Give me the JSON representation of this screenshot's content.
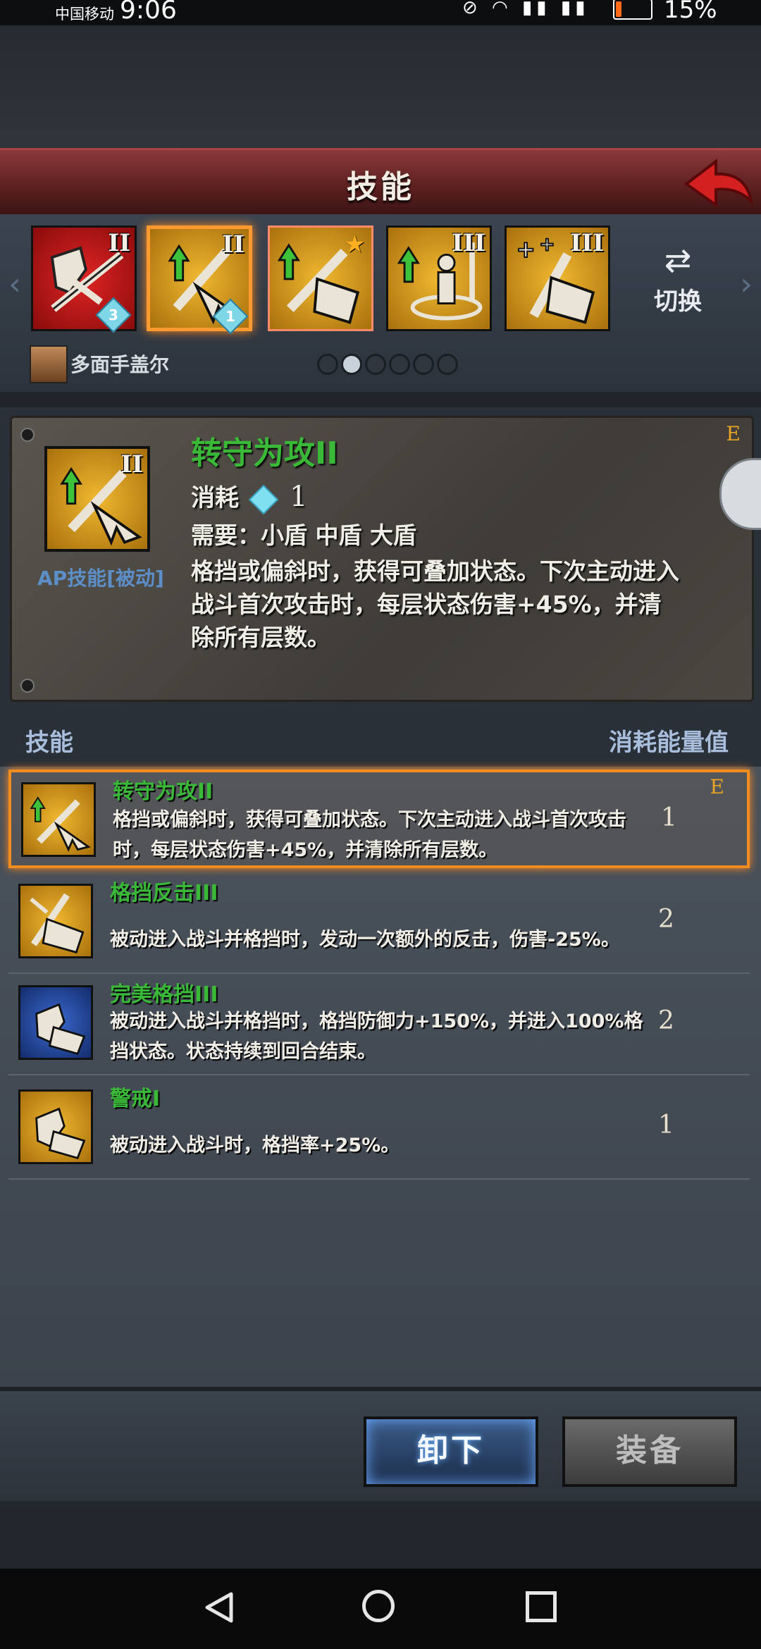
{
  "status_bar": {
    "carrier": "中国移动",
    "time": "9:06",
    "battery": "15%"
  },
  "header": {
    "title": "技能"
  },
  "skill_strip": {
    "slots": [
      {
        "rank": "II",
        "badge": "3",
        "icon": "shield-break-sword-icon"
      },
      {
        "rank": "II",
        "badge": "1",
        "icon": "sword-up-arrow-icon"
      },
      {
        "rank": "",
        "badge": "",
        "icon": "shield-parry-star-icon"
      },
      {
        "rank": "III",
        "badge": "",
        "icon": "guard-stance-icon"
      },
      {
        "rank": "III",
        "badge": "",
        "icon": "shield-plus-icon"
      }
    ],
    "switch_label": "切换",
    "character_name": "多面手盖尔",
    "page_count": 6,
    "active_page": 2
  },
  "detail": {
    "rank": "II",
    "ap_label": "AP技能[被动]",
    "title": "转守为攻II",
    "e_mark": "E",
    "cost_label": "消耗",
    "cost_value": "1",
    "requirement": "需要：小盾 中盾 大盾",
    "description": "格挡或偏斜时，获得可叠加状态。下次主动进入战斗首次攻击时，每层状态伤害+45%，并清除所有层数。"
  },
  "list_header": {
    "left": "技能",
    "right": "消耗能量值"
  },
  "skills": [
    {
      "name": "转守为攻II",
      "desc": "格挡或偏斜时，获得可叠加状态。下次主动进入战斗首次攻击时，每层状态伤害+45%，并清除所有层数。",
      "cost": "1",
      "e_mark": "E",
      "selected": true
    },
    {
      "name": "格挡反击III",
      "desc": "被动进入战斗并格挡时，发动一次额外的反击，伤害-25%。",
      "cost": "2"
    },
    {
      "name": "完美格挡III",
      "desc": "被动进入战斗并格挡时，格挡防御力+150%，并进入100%格挡状态。状态持续到回合结束。",
      "cost": "2"
    },
    {
      "name": "警戒I",
      "desc": "被动进入战斗时，格挡率+25%。",
      "cost": "1"
    }
  ],
  "buttons": {
    "unequip": "卸下",
    "equip": "装备"
  },
  "colors": {
    "skill_name": "#3ab838",
    "highlight": "#f08c20",
    "accent_blue": "#5c8ec8"
  }
}
